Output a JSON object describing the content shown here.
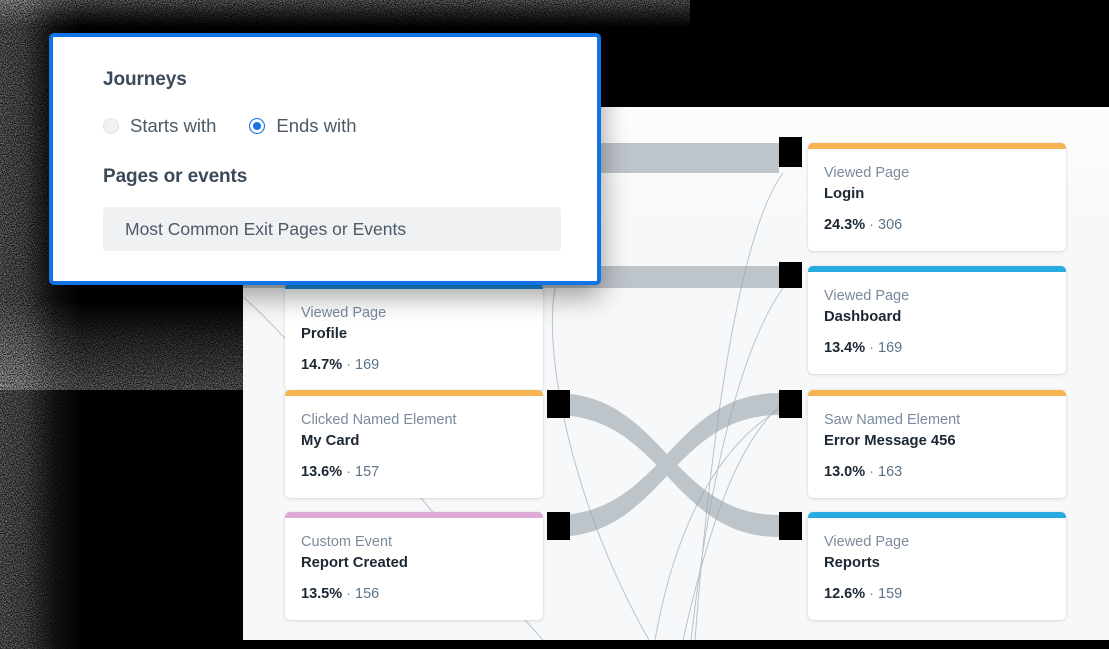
{
  "filter_panel": {
    "journeys_heading": "Journeys",
    "options": [
      {
        "label": "Starts with",
        "selected": false
      },
      {
        "label": "Ends with",
        "selected": true
      }
    ],
    "pages_heading": "Pages or events",
    "select_value": "Most Common Exit Pages or Events"
  },
  "colors": {
    "accent_blue": "#1273e6",
    "bar_orange": "#f5b352",
    "bar_blue": "#29abe2",
    "bar_pink": "#dda9d5",
    "flow_gray": "#bdc4ca",
    "node_black": "#000000",
    "panel_bg": "#f7f8f9"
  },
  "journey": {
    "left_nodes": [
      {
        "type": "Viewed Page",
        "title": "Profile",
        "percent": "14.7%",
        "separator": "·",
        "count": "169",
        "bar_color": "#1a8fe3"
      },
      {
        "type": "Clicked Named Element",
        "title": "My Card",
        "percent": "13.6%",
        "separator": "·",
        "count": "157",
        "bar_color": "#f5b352"
      },
      {
        "type": "Custom Event",
        "title": "Report Created",
        "percent": "13.5%",
        "separator": "·",
        "count": "156",
        "bar_color": "#dda9d5"
      }
    ],
    "right_nodes": [
      {
        "type": "Viewed Page",
        "title": "Login",
        "percent": "24.3%",
        "separator": "·",
        "count": "306",
        "bar_color": "#f5b352"
      },
      {
        "type": "Viewed Page",
        "title": "Dashboard",
        "percent": "13.4%",
        "separator": "·",
        "count": "169",
        "bar_color": "#29abe2"
      },
      {
        "type": "Saw Named Element",
        "title": "Error Message 456",
        "percent": "13.0%",
        "separator": "·",
        "count": "163",
        "bar_color": "#f5b352"
      },
      {
        "type": "Viewed Page",
        "title": "Reports",
        "percent": "12.6%",
        "separator": "·",
        "count": "159",
        "bar_color": "#29abe2"
      }
    ]
  }
}
